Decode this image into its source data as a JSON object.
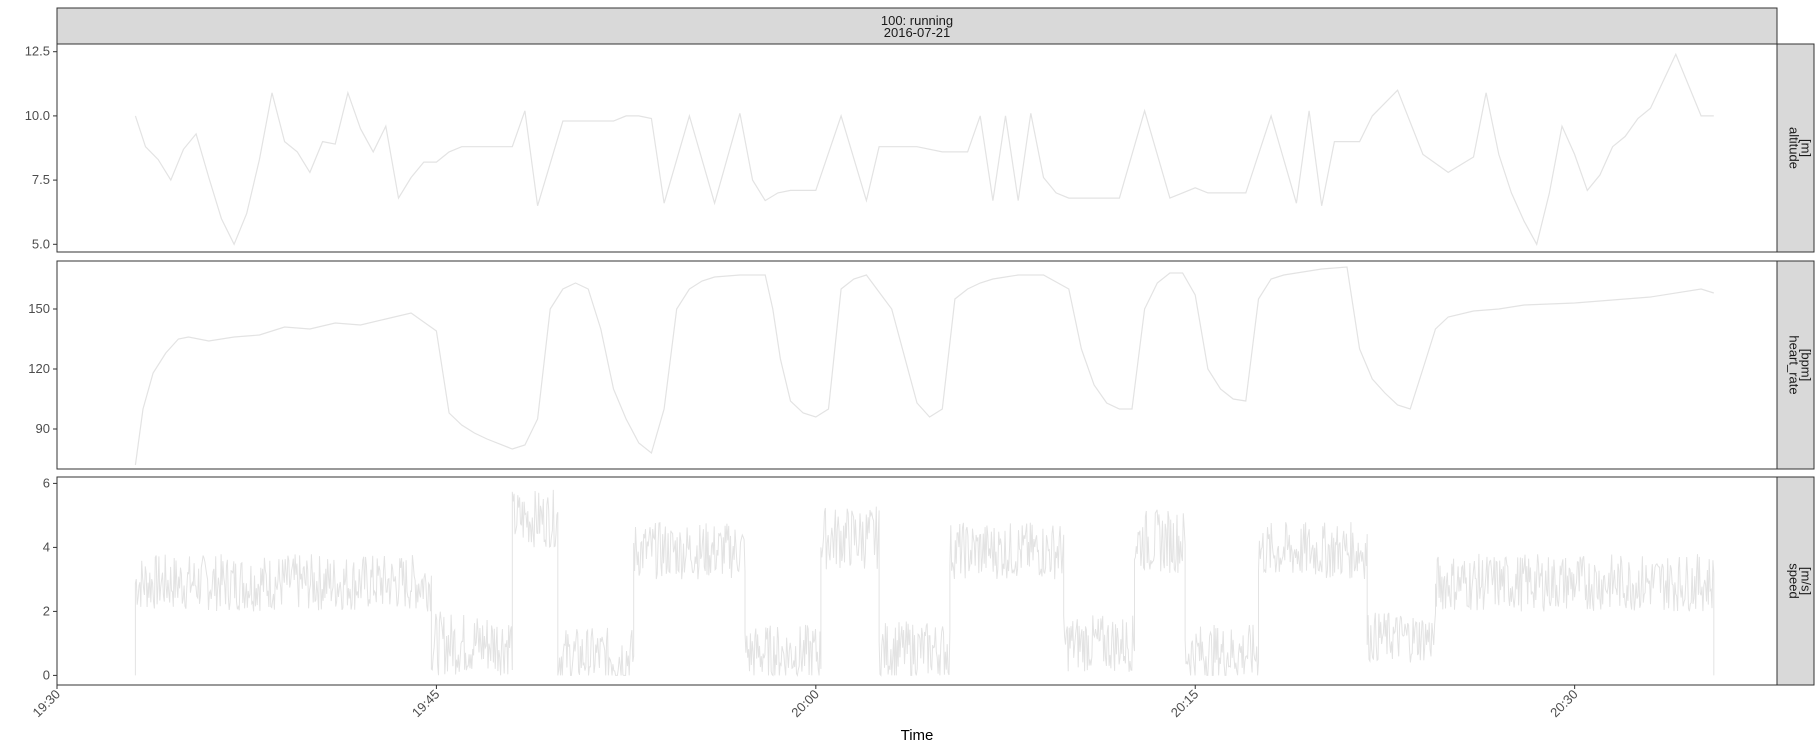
{
  "chart_data": {
    "type": "line",
    "title_lines": [
      "100: running",
      "2016-07-21"
    ],
    "xlabel": "Time",
    "x_ticks": [
      "19:30",
      "19:45",
      "20:00",
      "20:15",
      "20:30"
    ],
    "x_tick_minutes": [
      0,
      15,
      30,
      45,
      60
    ],
    "xlim_minutes": [
      0,
      68
    ],
    "line_color": "#e3e3e3",
    "strip_fill": "#d9d9d9",
    "grid": false,
    "panels": [
      {
        "strip_lines": [
          "altitude",
          "[m]"
        ],
        "ylim": [
          4.7,
          12.8
        ],
        "y_ticks": [
          5.0,
          7.5,
          10.0,
          12.5
        ],
        "y_tick_labels": [
          "5.0",
          "7.5",
          "10.0",
          "12.5"
        ],
        "x_minutes": [
          3.1,
          3.5,
          4.0,
          4.5,
          5.0,
          5.5,
          6.0,
          6.5,
          7.0,
          7.5,
          8.0,
          8.5,
          9.0,
          9.5,
          10.0,
          10.5,
          11.0,
          11.5,
          12.0,
          12.5,
          13.0,
          13.5,
          14.0,
          14.5,
          15.0,
          15.5,
          16.0,
          16.5,
          17.0,
          17.5,
          18.0,
          18.5,
          19.0,
          20.0,
          21.0,
          22.0,
          22.5,
          23.0,
          23.5,
          24.0,
          25.0,
          26.0,
          27.0,
          27.5,
          28.0,
          28.5,
          29.0,
          29.5,
          30.0,
          31.0,
          32.0,
          32.5,
          33.0,
          34.0,
          35.0,
          35.5,
          36.0,
          36.5,
          37.0,
          37.5,
          38.0,
          38.5,
          39.0,
          39.5,
          40.0,
          41.0,
          42.0,
          43.0,
          44.0,
          44.5,
          45.0,
          45.5,
          46.0,
          47.0,
          48.0,
          49.0,
          49.5,
          50.0,
          50.5,
          51.0,
          51.5,
          52.0,
          53.0,
          54.0,
          55.0,
          56.0,
          56.5,
          57.0,
          57.5,
          58.0,
          58.5,
          59.0,
          59.5,
          60.0,
          60.5,
          61.0,
          61.5,
          62.0,
          62.5,
          63.0,
          64.0,
          65.0,
          65.5
        ],
        "values": [
          10.0,
          8.8,
          8.3,
          7.5,
          8.7,
          9.3,
          7.6,
          6.0,
          5.0,
          6.2,
          8.3,
          10.9,
          9.0,
          8.6,
          7.8,
          9.0,
          8.9,
          10.9,
          9.5,
          8.6,
          9.6,
          6.8,
          7.6,
          8.2,
          8.2,
          8.6,
          8.8,
          8.8,
          8.8,
          8.8,
          8.8,
          10.2,
          6.5,
          9.8,
          9.8,
          9.8,
          10.0,
          10.0,
          9.9,
          6.6,
          10.0,
          6.6,
          10.1,
          7.5,
          6.7,
          7.0,
          7.1,
          7.1,
          7.1,
          10.0,
          6.7,
          8.8,
          8.8,
          8.8,
          8.6,
          8.6,
          8.6,
          10.0,
          6.7,
          10.0,
          6.7,
          10.1,
          7.6,
          7.0,
          6.8,
          6.8,
          6.8,
          10.2,
          6.8,
          7.0,
          7.2,
          7.0,
          7.0,
          7.0,
          10.0,
          6.6,
          10.2,
          6.5,
          9.0,
          9.0,
          9.0,
          10.0,
          11.0,
          8.5,
          7.8,
          8.4,
          10.9,
          8.5,
          7.0,
          5.9,
          5.0,
          7.0,
          9.6,
          8.5,
          7.1,
          7.7,
          8.8,
          9.2,
          9.9,
          10.3,
          12.4,
          10.0,
          10.0
        ]
      },
      {
        "strip_lines": [
          "heart_rate",
          "[bpm]"
        ],
        "ylim": [
          70,
          174
        ],
        "y_ticks": [
          90,
          120,
          150
        ],
        "y_tick_labels": [
          "90",
          "120",
          "150"
        ],
        "x_minutes": [
          3.1,
          3.4,
          3.8,
          4.3,
          4.8,
          5.2,
          6.0,
          6.5,
          7.0,
          8.0,
          9.0,
          10.0,
          11.0,
          12.0,
          13.0,
          14.0,
          15.0,
          15.5,
          16.0,
          16.5,
          17.0,
          18.0,
          18.5,
          19.0,
          19.5,
          20.0,
          20.5,
          21.0,
          21.5,
          22.0,
          22.5,
          23.0,
          23.5,
          24.0,
          24.5,
          25.0,
          25.5,
          26.0,
          27.0,
          28.0,
          28.3,
          28.6,
          29.0,
          29.5,
          30.0,
          30.5,
          31.0,
          31.5,
          32.0,
          33.0,
          34.0,
          34.5,
          35.0,
          35.5,
          36.0,
          36.5,
          37.0,
          37.5,
          38.0,
          39.0,
          40.0,
          40.5,
          41.0,
          41.5,
          42.0,
          42.5,
          43.0,
          43.5,
          44.0,
          44.5,
          45.0,
          45.5,
          46.0,
          46.5,
          47.0,
          47.5,
          48.0,
          48.5,
          49.0,
          50.0,
          51.0,
          51.5,
          52.0,
          52.5,
          53.0,
          53.5,
          54.0,
          54.5,
          55.0,
          56.0,
          57.0,
          58.0,
          60.0,
          62.0,
          63.0,
          65.0,
          65.5
        ],
        "values": [
          72,
          100,
          118,
          128,
          135,
          136,
          134,
          135,
          136,
          137,
          141,
          140,
          143,
          142,
          145,
          148,
          139,
          98,
          92,
          88,
          85,
          80,
          82,
          95,
          150,
          160,
          163,
          160,
          140,
          110,
          95,
          83,
          78,
          100,
          150,
          160,
          164,
          166,
          167,
          167,
          150,
          125,
          104,
          98,
          96,
          100,
          160,
          165,
          167,
          150,
          103,
          96,
          100,
          155,
          160,
          163,
          165,
          166,
          167,
          167,
          160,
          130,
          112,
          103,
          100,
          100,
          150,
          163,
          168,
          168,
          157,
          120,
          110,
          105,
          104,
          155,
          165,
          167,
          168,
          170,
          171,
          130,
          115,
          108,
          102,
          100,
          120,
          140,
          146,
          149,
          150,
          152,
          153,
          155,
          156,
          160,
          158
        ]
      },
      {
        "strip_lines": [
          "speed",
          "[m/s]"
        ],
        "ylim": [
          -0.3,
          6.2
        ],
        "y_ticks": [
          0,
          2,
          4,
          6
        ],
        "y_tick_labels": [
          "0",
          "2",
          "4",
          "6"
        ],
        "segments": [
          {
            "start": 3.1,
            "end": 14.8,
            "level": 2.9,
            "spread": 0.9
          },
          {
            "start": 14.8,
            "end": 18.0,
            "level": 1.0,
            "spread": 1.0
          },
          {
            "start": 18.0,
            "end": 19.8,
            "level": 4.9,
            "spread": 0.9
          },
          {
            "start": 19.8,
            "end": 22.8,
            "level": 0.6,
            "spread": 0.9
          },
          {
            "start": 22.8,
            "end": 27.2,
            "level": 3.9,
            "spread": 0.9
          },
          {
            "start": 27.2,
            "end": 30.2,
            "level": 0.7,
            "spread": 0.9
          },
          {
            "start": 30.2,
            "end": 32.5,
            "level": 4.3,
            "spread": 1.0
          },
          {
            "start": 32.5,
            "end": 35.3,
            "level": 0.8,
            "spread": 0.9
          },
          {
            "start": 35.3,
            "end": 39.8,
            "level": 3.9,
            "spread": 0.9
          },
          {
            "start": 39.8,
            "end": 42.6,
            "level": 1.0,
            "spread": 0.9
          },
          {
            "start": 42.6,
            "end": 44.6,
            "level": 4.2,
            "spread": 1.0
          },
          {
            "start": 44.6,
            "end": 47.5,
            "level": 0.7,
            "spread": 0.9
          },
          {
            "start": 47.5,
            "end": 51.8,
            "level": 3.9,
            "spread": 0.9
          },
          {
            "start": 51.8,
            "end": 54.5,
            "level": 1.2,
            "spread": 0.8
          },
          {
            "start": 54.5,
            "end": 65.5,
            "level": 2.9,
            "spread": 0.9
          }
        ]
      }
    ]
  }
}
